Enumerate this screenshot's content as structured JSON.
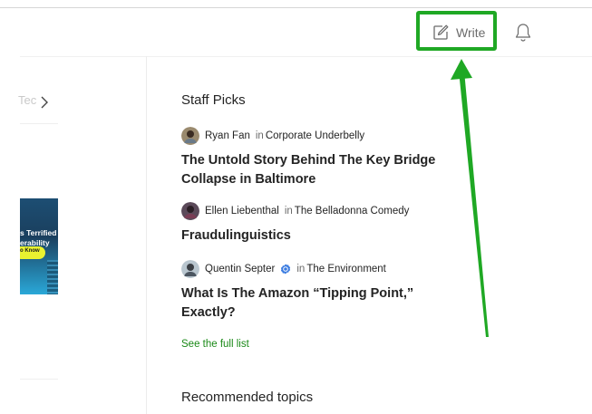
{
  "header": {
    "write_label": "Write",
    "icons": [
      "write-icon",
      "bell-icon"
    ]
  },
  "left": {
    "tab_label": "Tec",
    "thumbnail": {
      "line1": "s Terrified",
      "line2": "erability",
      "pill": "o Know"
    }
  },
  "staff_picks": {
    "title": "Staff Picks",
    "items": [
      {
        "author": "Ryan Fan",
        "in_word": "in",
        "publication": "Corporate Underbelly",
        "title": "The Untold Story Behind The Key Bridge Collapse in Baltimore"
      },
      {
        "author": "Ellen Liebenthal",
        "in_word": "in",
        "publication": "The Belladonna Comedy",
        "title": "Fraudulinguistics"
      },
      {
        "author": "Quentin Septer",
        "in_word": "in",
        "publication": "The Environment",
        "title": "What Is The Amazon “Tipping Point,” Exactly?"
      }
    ],
    "see_all": "See the full list"
  },
  "recommended": {
    "title": "Recommended topics"
  },
  "colors": {
    "highlight": "#1fa824",
    "link_green": "#1a8917",
    "badge_blue": "#3a7be0"
  }
}
